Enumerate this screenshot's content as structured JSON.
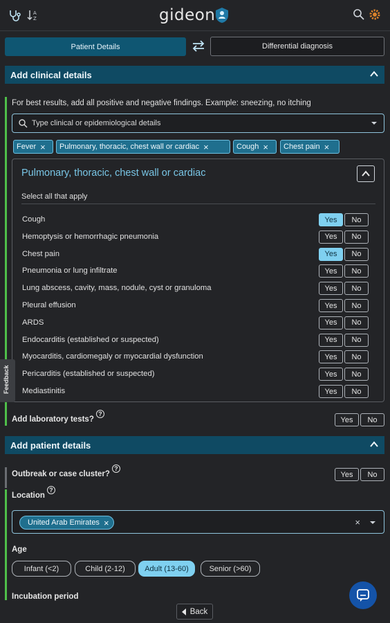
{
  "header": {
    "logo_text": "gideon",
    "icons": [
      "stethoscope-icon",
      "sort-icon",
      "search-icon",
      "settings-icon"
    ]
  },
  "view_toggle": {
    "active_label": "Patient Details",
    "inactive_label": "Differential diagnosis"
  },
  "clinical": {
    "section_title": "Add clinical details",
    "hint": "For best results, add all positive and negative findings. Example: sneezing, no itching",
    "search_placeholder": "Type clinical or epidemiological details",
    "chips": [
      "Fever",
      "Pulmonary, thoracic, chest wall or cardiac",
      "Cough",
      "Chest pain"
    ],
    "panel": {
      "title": "Pulmonary, thoracic, chest wall or cardiac",
      "subtitle": "Select all that apply",
      "yes_label": "Yes",
      "no_label": "No",
      "questions": [
        {
          "label": "Cough",
          "selected": "Yes"
        },
        {
          "label": "Hemoptysis or hemorrhagic pneumonia",
          "selected": ""
        },
        {
          "label": "Chest pain",
          "selected": "Yes"
        },
        {
          "label": "Pneumonia or lung infiltrate",
          "selected": ""
        },
        {
          "label": "Lung abscess, cavity, mass, nodule, cyst or granuloma",
          "selected": ""
        },
        {
          "label": "Pleural effusion",
          "selected": ""
        },
        {
          "label": "ARDS",
          "selected": ""
        },
        {
          "label": "Endocarditis (established or suspected)",
          "selected": ""
        },
        {
          "label": "Myocarditis, cardiomegaly or myocardial dysfunction",
          "selected": ""
        },
        {
          "label": "Pericarditis (established or suspected)",
          "selected": ""
        },
        {
          "label": "Mediastinitis",
          "selected": ""
        }
      ]
    },
    "lab_question": "Add laboratory tests?",
    "help_mark": "?"
  },
  "patient": {
    "section_title": "Add patient details",
    "outbreak_question": "Outbreak or case cluster?",
    "location_label": "Location",
    "location_value": "United Arab Emirates",
    "clear_mark": "×",
    "age_label": "Age",
    "age_options": [
      {
        "label": "Infant (<2)",
        "selected": false
      },
      {
        "label": "Child (2-12)",
        "selected": false
      },
      {
        "label": "Adult (13-60)",
        "selected": true
      },
      {
        "label": "Senior (>60)",
        "selected": false
      }
    ],
    "incubation_label": "Incubation period"
  },
  "feedback_label": "Feedback",
  "footer": {
    "back_label": "Back"
  },
  "colors": {
    "background": "#232427",
    "section_header": "#0f4a63",
    "accent_selected": "#7fd0f0",
    "rail_green": "#4fbf4a",
    "panel_title": "#79c6e6",
    "chat_button": "#1453a8"
  }
}
